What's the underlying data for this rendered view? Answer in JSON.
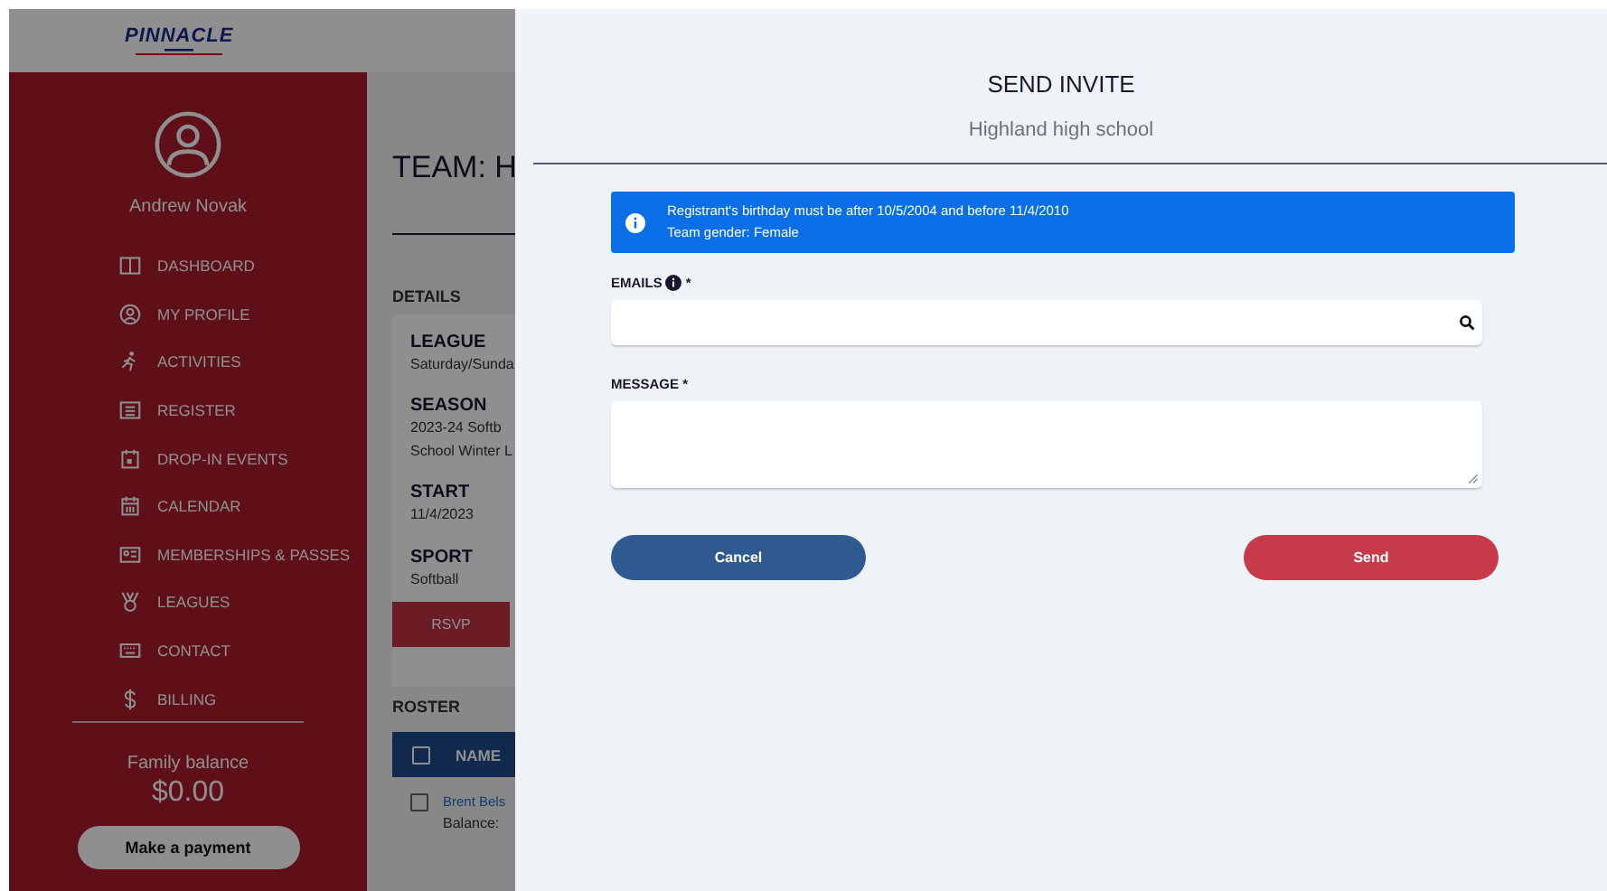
{
  "header": {
    "logo": {
      "name": "PINNACLE"
    }
  },
  "sidebar": {
    "user_name": "Andrew Novak",
    "items": [
      {
        "label": "DASHBOARD",
        "kind": "dashboard"
      },
      {
        "label": "MY PROFILE",
        "kind": "profile"
      },
      {
        "label": "ACTIVITIES",
        "kind": "runner"
      },
      {
        "label": "REGISTER",
        "kind": "list"
      },
      {
        "label": "DROP-IN EVENTS",
        "kind": "event"
      },
      {
        "label": "CALENDAR",
        "kind": "calendar"
      },
      {
        "label": "MEMBERSHIPS & PASSES",
        "kind": "card"
      },
      {
        "label": "LEAGUES",
        "kind": "medal"
      },
      {
        "label": "CONTACT",
        "kind": "keyboard"
      },
      {
        "label": "BILLING",
        "kind": "dollar"
      }
    ],
    "balance_label": "Family balance",
    "balance": "$0.00",
    "payment_button": "Make a payment"
  },
  "team_page": {
    "title": "TEAM: H",
    "details_heading": "DETAILS",
    "details": [
      {
        "label": "LEAGUE",
        "lines": [
          "Saturday/Sunda"
        ]
      },
      {
        "label": "SEASON",
        "lines": [
          "2023-24 Softb",
          "School Winter L"
        ]
      },
      {
        "label": "START",
        "lines": [
          "11/4/2023"
        ]
      },
      {
        "label": "SPORT",
        "lines": [
          "Softball"
        ]
      }
    ],
    "rsvp_button": "RSVP",
    "roster_heading": "ROSTER",
    "roster": {
      "header_checked": false,
      "columns": [
        "NAME"
      ],
      "rows": [
        {
          "name": "Brent Bels",
          "balance": "Balance:",
          "checked": false
        }
      ]
    }
  },
  "modal": {
    "title": "SEND INVITE",
    "subtitle": "Highland high school",
    "alert": [
      "Registrant's birthday must be after 10/5/2004 and before 11/4/2010",
      "Team gender: Female"
    ],
    "emails_label": "EMAILS",
    "emails_required": "*",
    "message_label": "MESSAGE *",
    "buttons": [
      {
        "label": "Cancel",
        "kind": "secondary"
      },
      {
        "label": "Send",
        "kind": "primary"
      }
    ]
  }
}
